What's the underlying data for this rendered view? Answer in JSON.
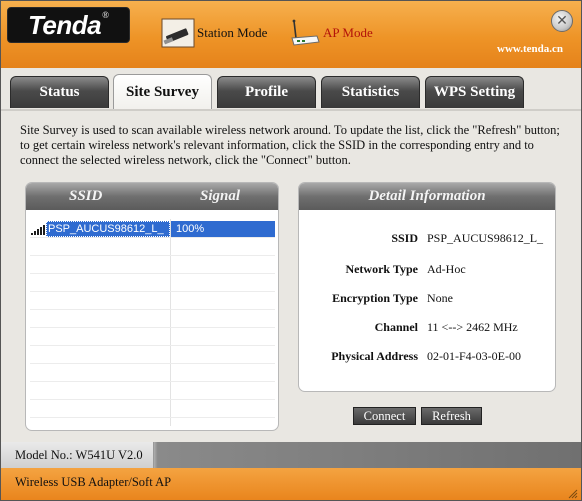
{
  "header": {
    "logo_text": "Tenda",
    "logo_mark": "®",
    "station_mode_label": "Station Mode",
    "ap_mode_label": "AP Mode",
    "website": "www.tenda.cn",
    "close_glyph": "✕"
  },
  "tabs": [
    {
      "label": "Status"
    },
    {
      "label": "Site Survey"
    },
    {
      "label": "Profile"
    },
    {
      "label": "Statistics"
    },
    {
      "label": "WPS Setting"
    }
  ],
  "active_tab": "Site Survey",
  "description": "Site Survey is used to scan available wireless network around. To update the list, click the \"Refresh\" button; to get certain wireless network's relevant information, click the SSID in the corresponding entry and to connect the selected wireless network, click the \"Connect\" button.",
  "network_list": {
    "col_ssid": "SSID",
    "col_signal": "Signal",
    "rows": [
      {
        "ssid": "PSP_AUCUS98612_L_",
        "signal": "100%",
        "selected": true
      }
    ]
  },
  "detail": {
    "title": "Detail Information",
    "fields": {
      "ssid": {
        "label": "SSID",
        "value": "PSP_AUCUS98612_L_"
      },
      "network_type": {
        "label": "Network Type",
        "value": "Ad-Hoc"
      },
      "encryption": {
        "label": "Encryption Type",
        "value": "None"
      },
      "channel": {
        "label": "Channel",
        "value": "11 <--> 2462 MHz"
      },
      "physical_address": {
        "label": "Physical Address",
        "value": "02-01-F4-03-0E-00"
      }
    }
  },
  "buttons": {
    "connect": "Connect",
    "refresh": "Refresh"
  },
  "footer": {
    "model": "Model No.: W541U V2.0",
    "product": "Wireless USB Adapter/Soft AP"
  },
  "colors": {
    "accent_orange": "#ee9427",
    "selection_blue": "#2f6bd0",
    "ap_mode_red": "#b3130a",
    "tab_dark": "#3a3a3a"
  },
  "icons": {
    "station_mode": "usb-adapter-icon",
    "ap_mode": "router-antenna-icon",
    "close": "close-icon",
    "signal": "signal-bars-icon"
  }
}
